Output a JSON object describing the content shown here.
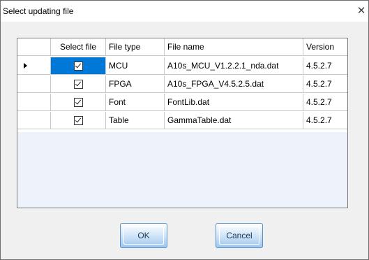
{
  "dialog": {
    "title": "Select updating file",
    "close_glyph": "✕"
  },
  "table": {
    "columns": [
      "",
      "Select file",
      "File type",
      "File name",
      "Version"
    ],
    "rows": [
      {
        "checked": true,
        "type": "MCU",
        "name": "A10s_MCU_V1.2.2.1_nda.dat",
        "version": "4.5.2.7"
      },
      {
        "checked": true,
        "type": "FPGA",
        "name": "A10s_FPGA_V4.5.2.5.dat",
        "version": "4.5.2.7"
      },
      {
        "checked": true,
        "type": "Font",
        "name": "FontLib.dat",
        "version": "4.5.2.7"
      },
      {
        "checked": true,
        "type": "Table",
        "name": "GammaTable.dat",
        "version": "4.5.2.7"
      }
    ],
    "selected_row": 0
  },
  "buttons": {
    "ok_label": "OK",
    "cancel_label": "Cancel"
  },
  "colors": {
    "selection": "#0078d7",
    "button_border": "#5b8fc7"
  }
}
